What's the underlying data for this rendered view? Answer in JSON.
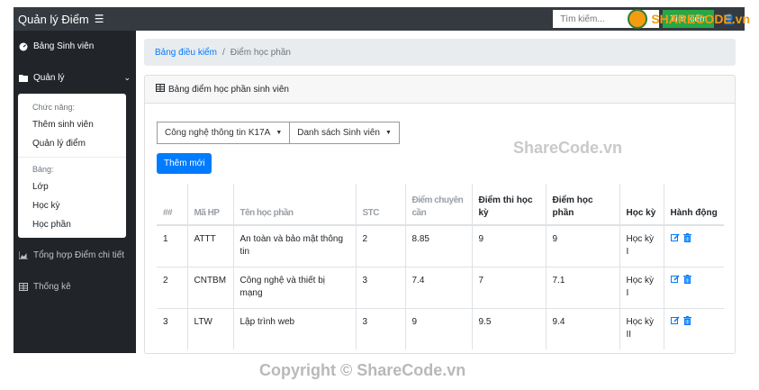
{
  "app": {
    "title": "Quản lý Điểm",
    "menu_icon": "hamburger-icon"
  },
  "search": {
    "placeholder": "Tìm kiếm...",
    "button": "Tìm kiếm"
  },
  "sidebar": {
    "dashboard": "Bảng Sinh viên",
    "manage": "Quản lý",
    "dropdown": {
      "header1": "Chức năng:",
      "items1": [
        "Thêm sinh viên",
        "Quản lý điểm"
      ],
      "header2": "Bảng:",
      "items2": [
        "Lớp",
        "Học kỳ",
        "Học phần"
      ]
    },
    "summary": "Tổng hợp Điểm chi tiết",
    "stats": "Thống kê"
  },
  "breadcrumb": {
    "link": "Bảng điều kiểm",
    "active": "Điểm học phần"
  },
  "card": {
    "title": "Bảng điểm học phần sinh viên",
    "filter1": "Công nghệ thông tin K17A",
    "filter2": "Danh sách Sinh viên",
    "add_button": "Thêm mới"
  },
  "table": {
    "headers": [
      "##",
      "Mã HP",
      "Tên học phần",
      "STC",
      "Điểm chuyên cần",
      "Điểm thi học kỳ",
      "Điểm học phần",
      "Học kỳ",
      "Hành động"
    ],
    "rows": [
      [
        "1",
        "ATTT",
        "An toàn và bảo mật thông tin",
        "2",
        "8.85",
        "9",
        "9",
        "Học kỳ I"
      ],
      [
        "2",
        "CNTBM",
        "Công nghệ và thiết bị mạng",
        "3",
        "7.4",
        "7",
        "7.1",
        "Học kỳ I"
      ],
      [
        "3",
        "LTW",
        "Lập trình web",
        "3",
        "9",
        "9.5",
        "9.4",
        "Học kỳ II"
      ]
    ]
  },
  "watermark": {
    "logo": "SHARECODE.vn",
    "middle": "ShareCode.vn",
    "bottom": "Copyright © ShareCode.vn"
  }
}
